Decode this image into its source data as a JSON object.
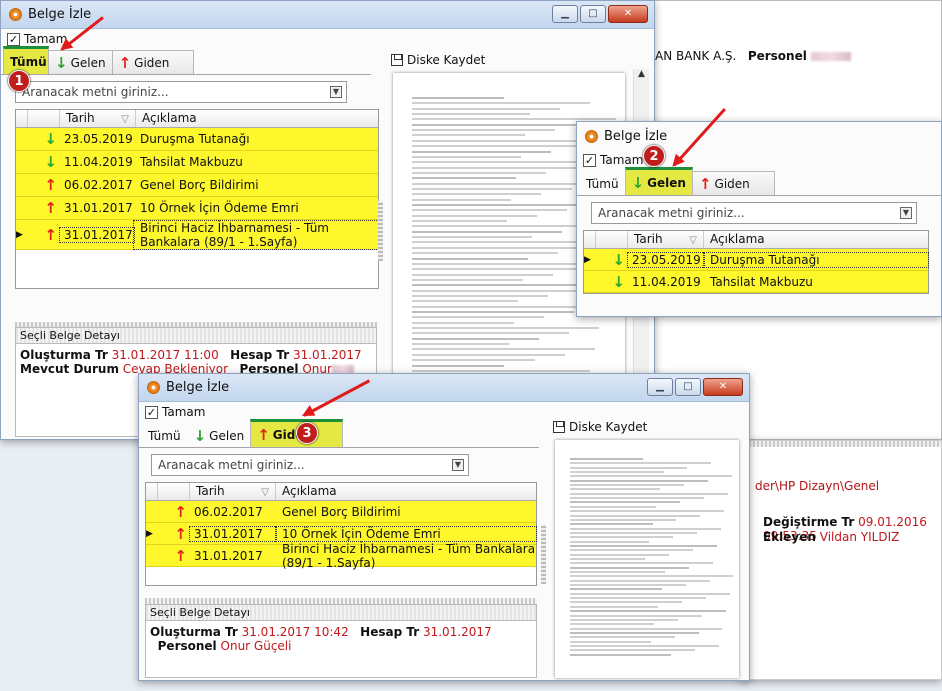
{
  "window_title": "Belge İzle",
  "tamam_label": "Tamam",
  "tabs": {
    "tumu": "Tümü",
    "gelen": "Gelen",
    "giden": "Giden"
  },
  "search_placeholder": "Aranacak metni giriniz...",
  "columns": {
    "date": "Tarih",
    "desc": "Açıklama"
  },
  "save_label": "Diske Kaydet",
  "detail_header": "Seçli Belge Detayı",
  "w1": {
    "rows": [
      {
        "dir": "in",
        "date": "23.05.2019",
        "desc": "Duruşma Tutanağı"
      },
      {
        "dir": "in",
        "date": "11.04.2019",
        "desc": "Tahsilat Makbuzu"
      },
      {
        "dir": "out",
        "date": "06.02.2017",
        "desc": "Genel Borç Bildirimi"
      },
      {
        "dir": "out",
        "date": "31.01.2017",
        "desc": "10 Örnek İçin Ödeme Emri"
      },
      {
        "dir": "out",
        "date": "31.01.2017",
        "desc": "Birinci Haciz İhbarnamesi - Tüm Bankalara (89/1 - 1.Sayfa)"
      }
    ],
    "detail": {
      "k1": "Oluşturma Tr",
      "v1": "31.01.2017 11:00",
      "k2": "Hesap Tr",
      "v2": "31.01.2017",
      "k3": "Mevcut Durum",
      "v3": "Cevap Bekleniyor",
      "k4": "Personel",
      "v4": "Onur"
    }
  },
  "w2": {
    "rows": [
      {
        "dir": "in",
        "date": "23.05.2019",
        "desc": "Duruşma Tutanağı"
      },
      {
        "dir": "in",
        "date": "11.04.2019",
        "desc": "Tahsilat Makbuzu"
      }
    ]
  },
  "w3": {
    "rows": [
      {
        "dir": "out",
        "date": "06.02.2017",
        "desc": "Genel Borç Bildirimi"
      },
      {
        "dir": "out",
        "date": "31.01.2017",
        "desc": "10 Örnek İçin Ödeme Emri"
      },
      {
        "dir": "out",
        "date": "31.01.2017",
        "desc": "Birinci Haciz İhbarnamesi - Tüm Bankalara (89/1 - 1.Sayfa)"
      }
    ],
    "detail": {
      "k1": "Oluşturma Tr",
      "v1": "31.01.2017 10:42",
      "k2": "Hesap Tr",
      "v2": "31.01.2017",
      "k3": "Personel",
      "v3": "Onur Güçeli"
    }
  },
  "background": {
    "bank_text": "AN BANK A.Ş.",
    "personel_label": "Personel",
    "path_text": "der\\HP Dizayn\\Genel",
    "mod_label": "Değiştirme Tr",
    "mod_value": "09.01.2016 09:53:35",
    "added_label": "Ekleyen",
    "added_value": "Vildan YILDIZ"
  },
  "badges": [
    "1",
    "2",
    "3"
  ],
  "colors": {
    "highlight": "#fdf72c",
    "accent_red": "#e01b1b",
    "value_red": "#c0171b"
  }
}
